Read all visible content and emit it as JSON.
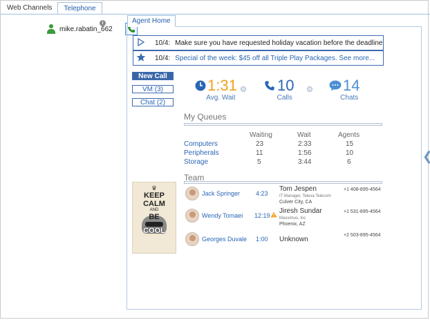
{
  "top_tabs": [
    {
      "label": "Web Channels",
      "active": false
    },
    {
      "label": "Telephone",
      "active": true
    }
  ],
  "user": {
    "name": "mike.rabatin_662",
    "info": "i",
    "status_color": "#3d9a3d"
  },
  "agent_tab": {
    "label": "Agent Home"
  },
  "announcements": [
    {
      "icon": "play-icon",
      "date": "10/4:",
      "text": "Make sure you have requested holiday vacation before the deadline"
    },
    {
      "icon": "star-icon",
      "date": "10/4:",
      "text": "Special of the week: $45 off all Triple Play Packages. See more..."
    }
  ],
  "side_buttons": [
    "New Call",
    "VM (3)",
    "Chat (2)"
  ],
  "stats": {
    "avg_wait": {
      "value": "1:31",
      "label": "Avg. Wait",
      "color": "#f2a01b"
    },
    "calls": {
      "value": "10",
      "label": "Calls",
      "color": "#2a66b6"
    },
    "chats": {
      "value": "14",
      "label": "Chats",
      "color": "#4a8fd4"
    }
  },
  "queues": {
    "title": "My Queues",
    "headers": [
      "Waiting",
      "Wait",
      "Agents"
    ],
    "rows": [
      {
        "name": "Computers",
        "waiting": "23",
        "wait": "2:33",
        "agents": "15"
      },
      {
        "name": "Peripherals",
        "waiting": "11",
        "wait": "1:56",
        "agents": "10"
      },
      {
        "name": "Storage",
        "waiting": "5",
        "wait": "3:44",
        "agents": "6"
      }
    ]
  },
  "poster": {
    "crown": "♛",
    "line1": "KEEP",
    "line2": "CALM",
    "line3": "AND",
    "line4": "BE",
    "line5": "COOL"
  },
  "team": {
    "title": "Team",
    "members": [
      {
        "name": "Jack Springer",
        "time": "4:23",
        "warning": false,
        "contact_name": "Tom Jespen",
        "contact_title": "IT Manager, Telexa Telecom",
        "contact_location": "Culver City, CA",
        "phone": "+1 408-895-4564"
      },
      {
        "name": "Wendy Tomaei",
        "time": "12:19",
        "warning": true,
        "contact_name": "Jiresh Sundar",
        "contact_title": "Maxximus, Inc",
        "contact_location": "Phoenix, AZ",
        "phone": "+1 531-895-4564"
      },
      {
        "name": "Georges Duvale",
        "time": "1:00",
        "warning": false,
        "contact_name": "Unknown",
        "contact_title": "",
        "contact_location": "",
        "phone": "+2 503-895-4564"
      }
    ]
  }
}
